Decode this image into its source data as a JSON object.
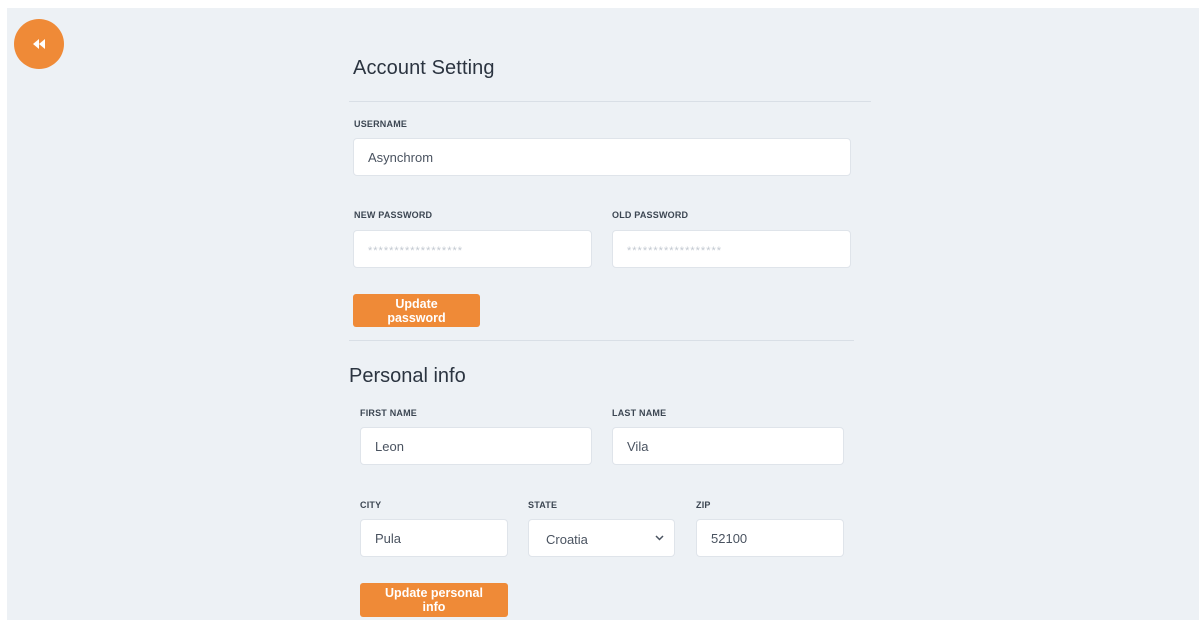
{
  "colors": {
    "accent": "#ef8a37",
    "background": "#edf1f5"
  },
  "back_button": {
    "icon": "double-chevron-left-icon"
  },
  "account": {
    "heading": "Account Setting",
    "username_label": "USERNAME",
    "username_value": "Asynchrom",
    "new_password_label": "NEW PASSWORD",
    "new_password_placeholder": "******************",
    "old_password_label": "OLD PASSWORD",
    "old_password_placeholder": "******************",
    "update_password_button": "Update password"
  },
  "personal": {
    "heading": "Personal info",
    "first_name_label": "FIRST NAME",
    "first_name_value": "Leon",
    "last_name_label": "LAST NAME",
    "last_name_value": "Vila",
    "city_label": "CITY",
    "city_value": "Pula",
    "state_label": "STATE",
    "state_value": "Croatia",
    "zip_label": "ZIP",
    "zip_value": "52100",
    "update_button": "Update personal info"
  }
}
